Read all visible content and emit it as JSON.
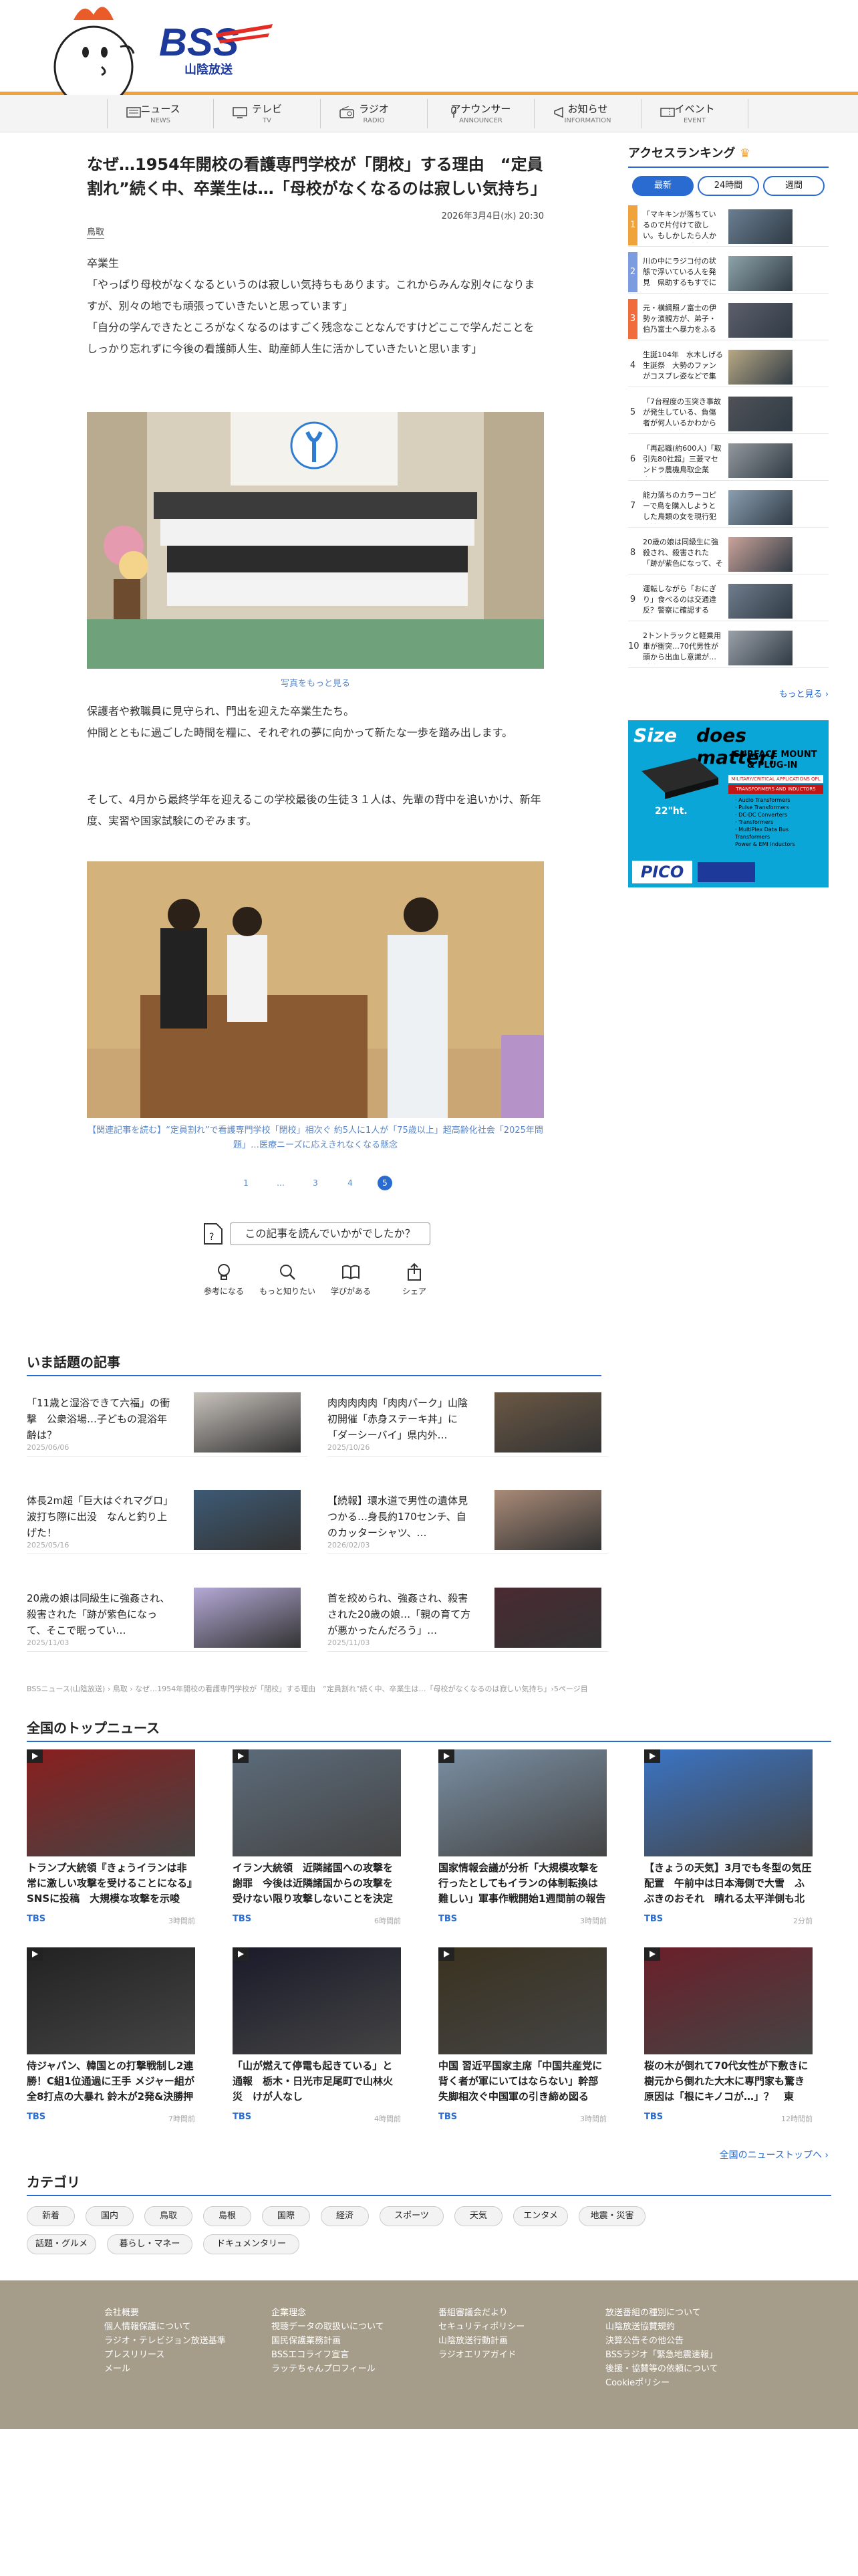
{
  "header": {
    "logo_text": "BSS",
    "logo_sub": "山陰放送"
  },
  "nav": [
    {
      "label": "ニュース",
      "sub": "NEWS",
      "icon": "news-icon"
    },
    {
      "label": "テレビ",
      "sub": "TV",
      "icon": "tv-icon"
    },
    {
      "label": "ラジオ",
      "sub": "RADIO",
      "icon": "radio-icon"
    },
    {
      "label": "アナウンサー",
      "sub": "ANNOUNCER",
      "icon": "microphone-icon"
    },
    {
      "label": "お知らせ",
      "sub": "INFORMATION",
      "icon": "megaphone-icon"
    },
    {
      "label": "イベント",
      "sub": "EVENT",
      "icon": "ticket-icon"
    }
  ],
  "article": {
    "title": "なぜ…1954年開校の看護専門学校が「閉校」する理由　“定員割れ”続く中、卒業生は…「母校がなくなるのは寂しい気持ち」",
    "date": "2026年3月4日(水) 20:30",
    "region": "鳥取",
    "p1": "卒業生\n「やっぱり母校がなくなるというのは寂しい気持ちもあります。これからみんな別々になりますが、別々の地でも頑張っていきたいと思っています」\n「自分の学んできたところがなくなるのはすごく残念なことなんですけどここで学んだことをしっかり忘れずに今後の看護師人生、助産師人生に活かしていきたいと思います」",
    "photo_more": "写真をもっと見る",
    "p2": "保護者や教職員に見守られ、門出を迎えた卒業生たち。\n仲間とともに過ごした時間を糧に、それぞれの夢に向かって新たな一歩を踏み出します。",
    "p3": "そして、4月から最終学年を迎えるこの学校最後の生徒３１人は、先輩の背中を追いかけ、新年度、実習や国家試験にのぞみます。",
    "related": "【関連記事を読む】“定員割れ”で看護専門学校「閉校」相次ぐ 約5人に1人が「75歳以上」超高齢化社会「2025年問題」…医療ニーズに応えきれなくなる懸念",
    "pages": [
      "1",
      "…",
      "3",
      "4",
      "5"
    ],
    "current_page": "5",
    "read_question": "この記事を読んでいかがでしたか？",
    "reactions": [
      "参考になる",
      "もっと知りたい",
      "学びがある",
      "シェア"
    ]
  },
  "sidebar": {
    "title": "アクセスランキング",
    "tabs": [
      "最新",
      "24時間",
      "週間"
    ],
    "ranking": [
      {
        "rank": "1",
        "text": "「マキキンが落ちているので片付けて欲しい。もしかしたら人かもしれない」 中心市…"
      },
      {
        "rank": "2",
        "text": "川の中にラジコ付の状態で浮いている人を発見　県助するもすでに亡くなった状態　第…"
      },
      {
        "rank": "3",
        "text": "元・横綱照ノ富士の伊勢ヶ濱親方が、弟子・伯乃富士へ暴力をふるったとされる問題…"
      },
      {
        "rank": "4",
        "text": "生誕104年　水木しげる生誕祭　大勢のファンがコスプレ姿などで集まりお祝い"
      },
      {
        "rank": "5",
        "text": "「7台程度の玉突き事故が発生している、負傷者が何人いるかわからない」 山陰道上…"
      },
      {
        "rank": "6",
        "text": "「再起職(約600人)「取引先80社超」三菱マセンドラ農機鳥取企業事・支援策を提案 …"
      },
      {
        "rank": "7",
        "text": "能力落ちのカラーコピーで鳥を購入しようとした鳥類の女を現行犯逮捕…以前にも同様被…"
      },
      {
        "rank": "8",
        "text": "20歳の娘は同級生に強殺され、殺害された「跡が紫色になって、そこで眠ってい…"
      },
      {
        "rank": "9",
        "text": "運転しながら「おにぎり」食べるのは交通違反？警察に確認すると…"
      },
      {
        "rank": "10",
        "text": "2トントラックと軽乗用車が衝突…70代男性が頭から出血し意識が…重篤はかり命に…"
      }
    ],
    "more": "もっと見る ›",
    "ad": {
      "headline1": "Size",
      "headline2": "does matter!",
      "product1": "SURFACE MOUNT",
      "product2": "& PLUG-IN",
      "band": "MILITARY/CRITICAL APPLICATIONS QPL UNITS STANDARD",
      "band2": "TRANSFORMERS AND INDUCTORS",
      "features": [
        "· Audio Transformers",
        "· Pulse Transformers",
        "· DC-DC Converters",
        "· Transformers",
        "· MultiPlex Data Bus Transformers",
        "Power & EMI Inductors"
      ],
      "brand": "PICO",
      "size_label": "22\"ht."
    }
  },
  "topics": {
    "title": "いま話題の記事",
    "items": [
      {
        "title": "「11歳と湿浴できて六福」の衝撃　公衆浴場…子どもの混浴年齢は？",
        "date": "2025/06/06"
      },
      {
        "title": "肉肉肉肉肉「肉肉パーク」山陰初開催「赤身ステーキ丼」に「ダーシーバイ」県内外…",
        "date": "2025/10/26"
      },
      {
        "title": "体長2m超「巨大はぐれマグロ」波打ち際に出没　なんと釣り上げた！",
        "date": "2025/05/16"
      },
      {
        "title": "【続報】環水道で男性の遺体見つかる…身長約170センチ、自のカッターシャツ、…",
        "date": "2026/02/03"
      },
      {
        "title": "20歳の娘は同級生に強姦され、殺害された「跡が紫色になって、そこで眠ってい…",
        "date": "2025/11/03"
      },
      {
        "title": "首を絞められ、強姦され、殺害された20歳の娘…「親の育て方が悪かったんだろう」…",
        "date": "2025/11/03"
      }
    ]
  },
  "breadcrumb": "BSSニュース(山陰放送) › 鳥取 › なぜ…1954年開校の看護専門学校が「閉校」する理由　“定員割れ”続く中、卒業生は…「母校がなくなるのは寂しい気持ち」›5ページ目",
  "national": {
    "title": "全国のトップニュース",
    "items": [
      {
        "title": "トランプ大統領『きょうイランは非常に激しい攻撃を受けることになる』SNSに投稿　大規模な攻撃を示唆",
        "source": "TBS",
        "time": "3時間前"
      },
      {
        "title": "イラン大統領　近隣諸国への攻撃を謝罪　今後は近隣諸国からの攻撃を受けない限り攻撃しないことを決定",
        "source": "TBS",
        "time": "6時間前"
      },
      {
        "title": "国家情報会議が分析「大規模攻撃を行ったとしてもイランの体制転換は難しい」軍事作戦開始1週間前の報告書で…",
        "source": "TBS",
        "time": "3時間前"
      },
      {
        "title": "【きょうの天気】3月でも冬型の気圧配置　午前中は日本海側で大雪　ふぶきのおそれ　晴れる太平洋側も北風と…",
        "source": "TBS",
        "time": "2分前"
      },
      {
        "title": "侍ジャパン、韓国との打撃戦制し2連勝！C組1位通過に王手 メジャー組が全8打点の大暴れ 鈴木が2発&決勝押し…",
        "source": "TBS",
        "time": "7時間前"
      },
      {
        "title": "「山が燃えて停電も起きている」と通報　栃木・日光市足尾町で山林火災　けが人なし",
        "source": "TBS",
        "time": "4時間前"
      },
      {
        "title": "中国 習近平国家主席「中国共産党に背く者が軍にいてはならない」幹部失脚相次ぐ中国軍の引き締め図る",
        "source": "TBS",
        "time": "3時間前"
      },
      {
        "title": "桜の木が倒れて70代女性が下敷きに　樹元から倒れた大木に専門家も驚き 原因は「根にキノコが…」？　東京・…",
        "source": "TBS",
        "time": "12時間前"
      }
    ],
    "more": "全国のニューストップへ ›"
  },
  "categories": {
    "title": "カテゴリ",
    "items": [
      "新着",
      "国内",
      "鳥取",
      "島根",
      "国際",
      "経済",
      "スポーツ",
      "天気",
      "エンタメ",
      "地震・災害",
      "話題・グルメ",
      "暮らし・マネー",
      "ドキュメンタリー"
    ]
  },
  "footer": {
    "col1": [
      "会社概要",
      "個人情報保護について",
      "ラジオ・テレビジョン放送基準",
      "プレスリリース",
      "メール"
    ],
    "col2": [
      "企業理念",
      "視聴データの取扱いについて",
      "国民保護業務計画",
      "BSSエコライフ宣言",
      "ラッテちゃんプロフィール"
    ],
    "col3": [
      "番組審議会だより",
      "セキュリティポリシー",
      "山陰放送行動計画",
      "ラジオエリアガイド"
    ],
    "col4": [
      "放送番組の種別について",
      "山陰放送協賛規約",
      "決算公告その他公告",
      "BSSラジオ「緊急地震速報」",
      "後援・協賛等の依頼について",
      "Cookieポリシー"
    ]
  },
  "colors": {
    "accent": "#2a6bd1",
    "header_border": "#f0a23b",
    "rank_top": "#f0a23b",
    "rank_2": "#7c9be0",
    "rank_3": "#f06c3b",
    "footer_bg": "#a69c8a"
  }
}
